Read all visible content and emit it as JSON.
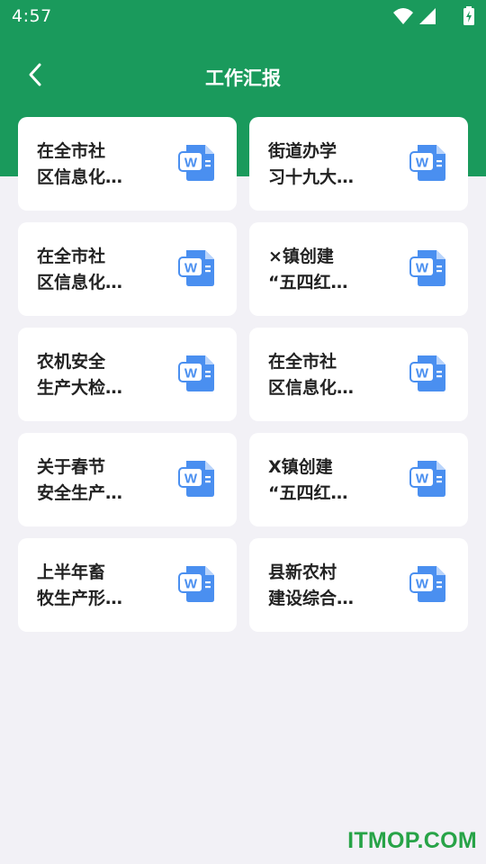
{
  "status_bar": {
    "time": "4:57"
  },
  "header": {
    "title": "工作汇报"
  },
  "documents": [
    {
      "line1": "在全市社",
      "line2": "区信息化…"
    },
    {
      "line1": "街道办学",
      "line2": "习十九大…"
    },
    {
      "line1": "在全市社",
      "line2": "区信息化…"
    },
    {
      "line1": "×镇创建",
      "line2": "“五四红…"
    },
    {
      "line1": "农机安全",
      "line2": "生产大检…"
    },
    {
      "line1": "在全市社",
      "line2": "区信息化…"
    },
    {
      "line1": "关于春节",
      "line2": "安全生产…"
    },
    {
      "line1": "X镇创建",
      "line2": "“五四红…"
    },
    {
      "line1": "上半年畜",
      "line2": "牧生产形…"
    },
    {
      "line1": "县新农村",
      "line2": "建设综合…"
    }
  ],
  "doc_icon": {
    "name": "word-document-icon",
    "glyph": "W",
    "color": "#4a8ff0"
  },
  "watermark": "ITMOP.COM",
  "colors": {
    "header": "#1a9a5c",
    "background": "#f2f1f6",
    "watermark": "#27a347"
  }
}
